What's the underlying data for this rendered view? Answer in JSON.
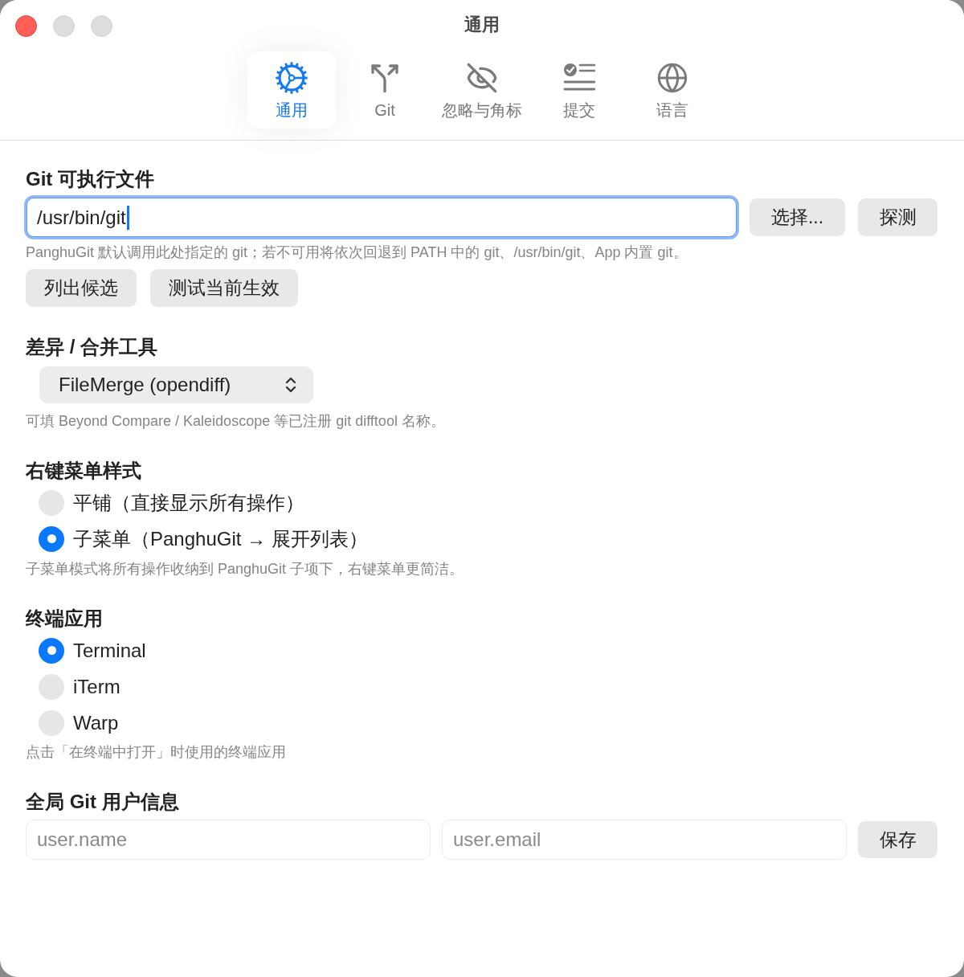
{
  "window": {
    "title": "通用"
  },
  "toolbar": {
    "tabs": [
      {
        "label": "通用",
        "selected": true
      },
      {
        "label": "Git",
        "selected": false
      },
      {
        "label": "忽略与角标",
        "selected": false
      },
      {
        "label": "提交",
        "selected": false
      },
      {
        "label": "语言",
        "selected": false
      }
    ]
  },
  "git_executable": {
    "heading": "Git 可执行文件",
    "path_field": {
      "value": "/usr/bin/git",
      "focused": true
    },
    "buttons": [
      "选择...",
      "探测"
    ],
    "hint": "PanghuGit 默认调用此处指定的 git；若不可用将依次回退到 PATH 中的 git、/usr/bin/git、App 内置 git。",
    "actions": [
      "列出候选",
      "测试当前生效"
    ]
  },
  "diff_tool": {
    "heading": "差异 / 合并工具",
    "select": {
      "value": "FileMerge (opendiff)"
    },
    "hint": "可填 Beyond Compare / Kaleidoscope 等已注册 git difftool 名称。"
  },
  "context_menu_style": {
    "heading": "右键菜单样式",
    "options": [
      {
        "label": "平铺（直接显示所有操作）",
        "selected": false
      },
      {
        "label": "子菜单（PanghuGit → 展开列表）",
        "selected": true
      }
    ],
    "hint": "子菜单模式将所有操作收纳到 PanghuGit 子项下，右键菜单更简洁。"
  },
  "terminal": {
    "heading": "终端应用",
    "options": [
      {
        "label": "Terminal",
        "selected": true
      },
      {
        "label": "iTerm",
        "selected": false
      },
      {
        "label": "Warp",
        "selected": false
      }
    ],
    "hint": "点击「在终端中打开」时使用的终端应用"
  },
  "git_user": {
    "heading": "全局 Git 用户信息",
    "fields": [
      {
        "placeholder": "user.name"
      },
      {
        "placeholder": "user.email"
      }
    ],
    "button": "保存"
  }
}
